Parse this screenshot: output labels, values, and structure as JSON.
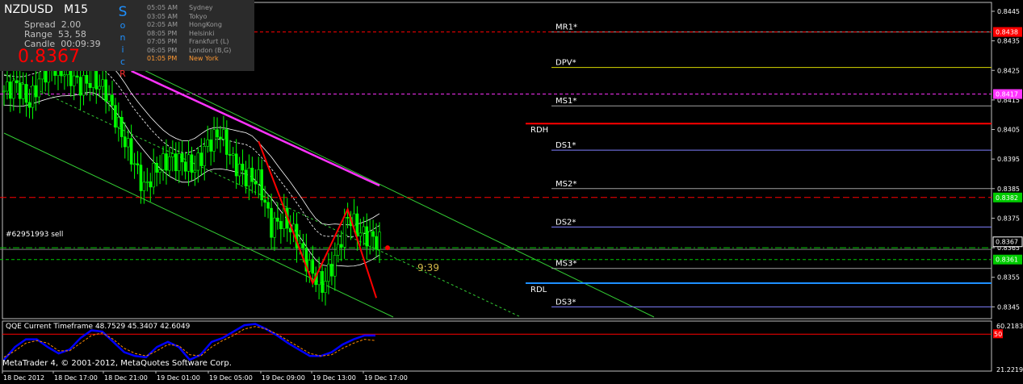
{
  "hud": {
    "symbol": "NZDUSD",
    "timeframe": "M15",
    "spread_label": "Spread",
    "spread_value": "2.00",
    "range_label": "Range",
    "range_value": "53, 58",
    "candle_label": "Candle",
    "candle_value": "00:09:39",
    "price": "0.8367",
    "brand_letters": [
      "S",
      "o",
      "n",
      "i",
      "c",
      "R"
    ]
  },
  "sessions": [
    {
      "time": "05:05 AM",
      "city": "Sydney",
      "state": "closed"
    },
    {
      "time": "03:05 AM",
      "city": "Tokyo",
      "state": "closed"
    },
    {
      "time": "02:05 AM",
      "city": "HongKong",
      "state": "closed"
    },
    {
      "time": "08:05 PM",
      "city": "Helsinki",
      "state": "closed"
    },
    {
      "time": "07:05 PM",
      "city": "Frankfurt  (L)",
      "state": "closed"
    },
    {
      "time": "06:05 PM",
      "city": "London  (B,G)",
      "state": "closed"
    },
    {
      "time": "01:05 PM",
      "city": "New York",
      "state": "open"
    }
  ],
  "order_label": "#62951993 sell",
  "timer_label": "9:39",
  "footer": "MetaTrader 4, © 2001-2012, MetaQuotes Software Corp.",
  "colors": {
    "background": "#000000",
    "candle_bull": "#00ff00",
    "candle_bear": "#00ff00",
    "channel": "#33cc33",
    "ma_slow": "#ff33ff",
    "envelope": "#ffffff",
    "zigzag": "#ff0000",
    "qqe_main": "#0000ff",
    "qqe_signal": "#ff8800"
  },
  "chart_data": [
    {
      "type": "candlestick",
      "symbol": "NZDUSD",
      "timeframe": "M15",
      "y_ticks": [
        "0.8445",
        "0.8435",
        "0.8425",
        "0.8415",
        "0.8405",
        "0.8395",
        "0.8385",
        "0.8375",
        "0.8365",
        "0.8355",
        "0.8345"
      ],
      "ylim": [
        0.8341,
        0.8448
      ],
      "x_ticks": [
        "18 Dec 2012",
        "18 Dec 17:00",
        "18 Dec 21:00",
        "19 Dec 01:00",
        "19 Dec 05:00",
        "19 Dec 09:00",
        "19 Dec 13:00",
        "19 Dec 17:00"
      ],
      "price_path": [
        {
          "t": 0,
          "p": 0.8418
        },
        {
          "t": 2,
          "p": 0.842
        },
        {
          "t": 4,
          "p": 0.8414
        },
        {
          "t": 6,
          "p": 0.8424
        },
        {
          "t": 8,
          "p": 0.8426
        },
        {
          "t": 10,
          "p": 0.8424
        },
        {
          "t": 12,
          "p": 0.842
        },
        {
          "t": 14,
          "p": 0.8422
        },
        {
          "t": 16,
          "p": 0.8418
        },
        {
          "t": 18,
          "p": 0.8406
        },
        {
          "t": 20,
          "p": 0.8396
        },
        {
          "t": 22,
          "p": 0.8385
        },
        {
          "t": 24,
          "p": 0.8392
        },
        {
          "t": 26,
          "p": 0.8395
        },
        {
          "t": 28,
          "p": 0.8394
        },
        {
          "t": 30,
          "p": 0.8392
        },
        {
          "t": 32,
          "p": 0.84
        },
        {
          "t": 34,
          "p": 0.8404
        },
        {
          "t": 36,
          "p": 0.8394
        },
        {
          "t": 38,
          "p": 0.8389
        },
        {
          "t": 40,
          "p": 0.8388
        },
        {
          "t": 42,
          "p": 0.8372
        },
        {
          "t": 44,
          "p": 0.8375
        },
        {
          "t": 46,
          "p": 0.8368
        },
        {
          "t": 48,
          "p": 0.8358
        },
        {
          "t": 50,
          "p": 0.8352
        },
        {
          "t": 52,
          "p": 0.8361
        },
        {
          "t": 54,
          "p": 0.8376
        },
        {
          "t": 56,
          "p": 0.837
        },
        {
          "t": 58,
          "p": 0.8368
        },
        {
          "t": 59,
          "p": 0.8367
        }
      ],
      "horizontal_levels": [
        {
          "label": "MR1*",
          "price": 0.8438,
          "color": "#a0a0a0"
        },
        {
          "label": "DPV*",
          "price": 0.8426,
          "color": "#d8d800"
        },
        {
          "label": "MS1*",
          "price": 0.8413,
          "color": "#a0a0a0"
        },
        {
          "label": "RDH",
          "price": 0.8407,
          "color": "#ff0000"
        },
        {
          "label": "DS1*",
          "price": 0.8398,
          "color": "#8080ff"
        },
        {
          "label": "MS2*",
          "price": 0.8385,
          "color": "#a0a0a0"
        },
        {
          "label": "DS2*",
          "price": 0.8372,
          "color": "#8080ff"
        },
        {
          "label": "MS3*",
          "price": 0.8358,
          "color": "#a0a0a0"
        },
        {
          "label": "RDL",
          "price": 0.8353,
          "color": "#1e90ff"
        },
        {
          "label": "DS3*",
          "price": 0.8345,
          "color": "#8080ff"
        }
      ],
      "price_tags": [
        {
          "label": "0.8438",
          "color": "#ff0000"
        },
        {
          "label": "0.8417",
          "color": "#ff33ff"
        },
        {
          "label": "0.8382",
          "color": "#00cc00"
        },
        {
          "label": "0.8367",
          "color": "#000000"
        },
        {
          "label": "0.8361",
          "color": "#00cc00"
        }
      ],
      "current_price": 0.8367,
      "order_price": 0.8365
    },
    {
      "type": "line",
      "title": "QQE Current Timeframe 48.7529 45.3407 42.6049",
      "y_ticks": [
        "60.2183",
        "50",
        "21.2219"
      ],
      "ylim": [
        21.2219,
        60.2183
      ],
      "series": [
        {
          "color": "#0000ff",
          "values": [
            30,
            40,
            46,
            46,
            40,
            35,
            38,
            47,
            53,
            52,
            44,
            36,
            33,
            32,
            40,
            44,
            40,
            30,
            34,
            44,
            47,
            52,
            57,
            58,
            54,
            49,
            43,
            38,
            33,
            33,
            36,
            42,
            46,
            49,
            49
          ]
        },
        {
          "color": "#ff8800",
          "values": [
            32,
            37,
            43,
            45,
            43,
            37,
            37,
            43,
            49,
            51,
            46,
            39,
            35,
            33,
            37,
            42,
            41,
            34,
            33,
            40,
            45,
            49,
            54,
            56,
            54,
            50,
            45,
            40,
            35,
            33,
            34,
            39,
            43,
            46,
            45
          ]
        }
      ]
    }
  ]
}
